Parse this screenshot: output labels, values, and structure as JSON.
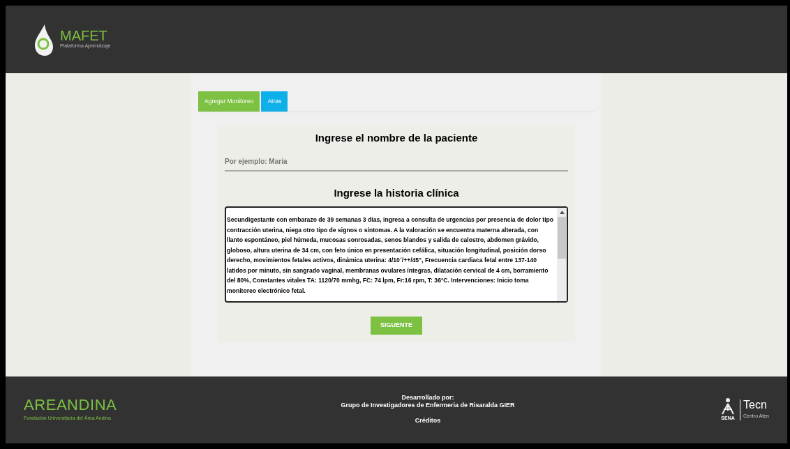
{
  "header": {
    "logo_title": "MAFET",
    "logo_subtitle": "Plataforma Aprendizaje"
  },
  "tabs": [
    {
      "label": "Agregar Monitoreo",
      "color": "#7dc142"
    },
    {
      "label": "Atras",
      "color": "#0eb0ea"
    }
  ],
  "form": {
    "name_heading": "Ingrese el nombre de la paciente",
    "name_field": {
      "placeholder": "Por ejemplo: María"
    },
    "history_heading": "Ingrese la historia clínica",
    "history_value": "Secundigestante con embarazo de 39 semanas 3 días, ingresa a consulta de urgencias por presencia de dolor tipo contracción uterina, niega otro tipo de signos o síntomas. A la valoración se encuentra materna alterada, con llanto espontáneo, piel húmeda, mucosas sonrosadas, senos blandos y salida de calostro, abdomen grávido,  globoso, altura uterina de 34 cm, con feto único en presentación cefálica, situación longitudinal, posición dorso derecho, movimientos fetales activos, dinámica uterina: 4/10´/++/45\", Frecuencia cardiaca fetal entre 137-140 latidos por minuto, sin sangrado vaginal, membranas ovulares íntegras, dilatación cervical de 4 cm, borramiento del 80%, Constantes vitales TA: 1120/70 mmhg, FC: 74 lpm, Fr:16 rpm, T: 36°C. Intervenciones: Inicio toma monitoreo electrónico fetal.",
    "submit": "SIGUENTE"
  },
  "footer": {
    "left_logo_title": "AREANDINA",
    "left_logo_subtitle": "Fundación Universitaria del Área Andina",
    "credit_lines": [
      "Desarrollado por:",
      "Grupo de Investigadores de Enfermeria de Risaralda GIER"
    ],
    "credits_link": "Créditos",
    "right_logo_mark": "SENA",
    "right_logo_title": "Tecn",
    "right_logo_subtitle": "Centro Aten"
  }
}
